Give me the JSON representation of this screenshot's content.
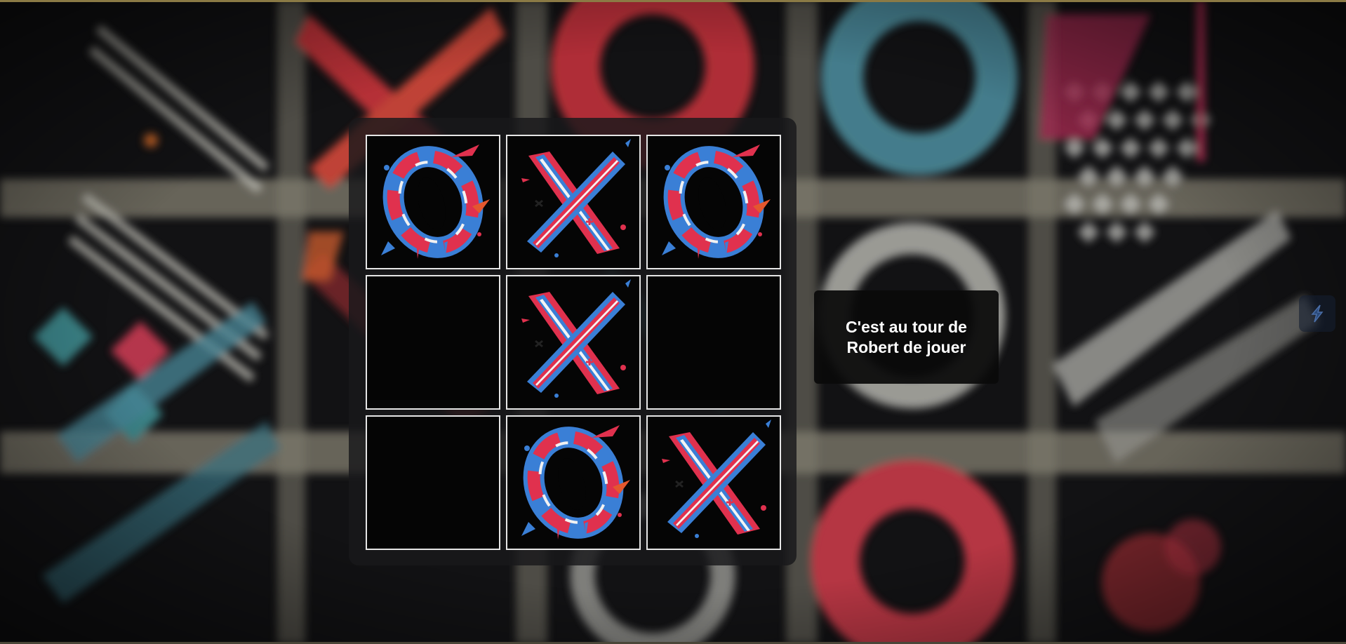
{
  "status": {
    "turn_message": "C'est au tour de Robert de jouer"
  },
  "board": {
    "cells": [
      "O",
      "X",
      "O",
      "",
      "X",
      "",
      "",
      "O",
      "X"
    ]
  },
  "icons": {
    "o_mark": "graffiti-o-icon",
    "x_mark": "graffiti-x-icon",
    "side": "lightning-icon"
  },
  "colors": {
    "mark_red": "#e0314e",
    "mark_blue": "#3a7fd6",
    "panel": "#19191b",
    "cell_border": "#e6e6e6"
  }
}
